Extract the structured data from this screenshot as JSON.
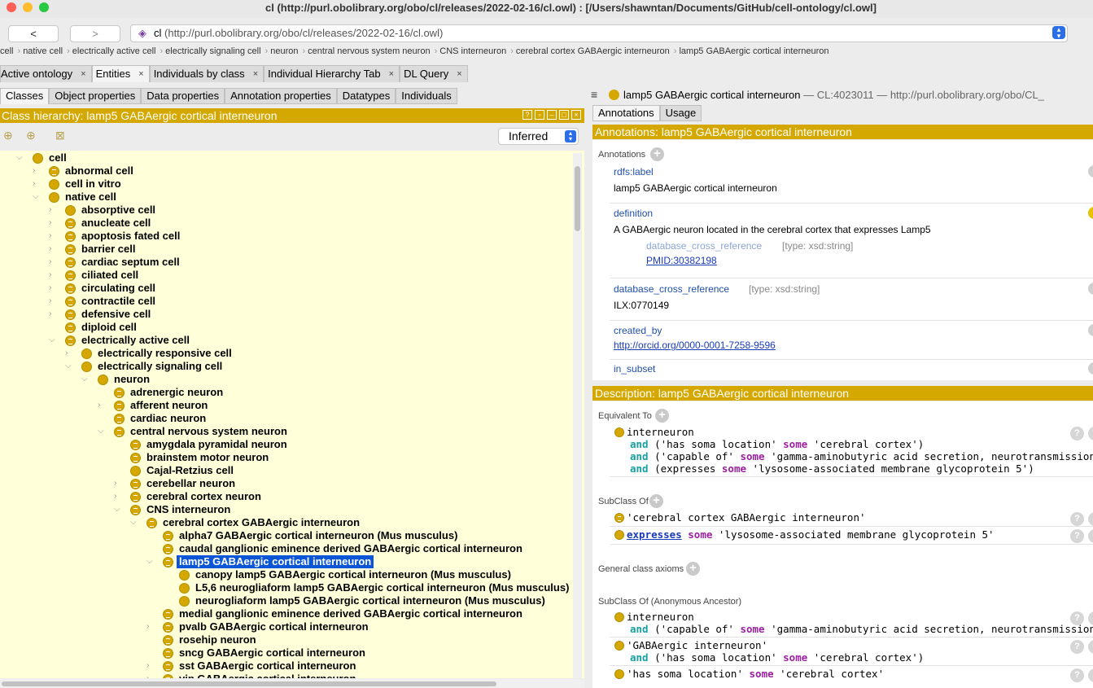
{
  "window": {
    "title": "cl (http://purl.obolibrary.org/obo/cl/releases/2022-02-16/cl.owl)  : [/Users/shawntan/Documents/GitHub/cell-ontology/cl.owl]"
  },
  "nav": {
    "back": "<",
    "forward": ">",
    "url_name": "cl",
    "url_rest": "(http://purl.obolibrary.org/obo/cl/releases/2022-02-16/cl.owl)"
  },
  "breadcrumbs": [
    "cell",
    "native cell",
    "electrically active cell",
    "electrically signaling cell",
    "neuron",
    "central nervous system neuron",
    "CNS interneuron",
    "cerebral cortex GABAergic interneuron",
    "lamp5 GABAergic cortical interneuron"
  ],
  "main_tabs": [
    {
      "label": "Active ontology",
      "close": "×"
    },
    {
      "label": "Entities",
      "close": "×"
    },
    {
      "label": "Individuals by class",
      "close": "×"
    },
    {
      "label": "Individual Hierarchy Tab",
      "close": "×"
    },
    {
      "label": "DL Query",
      "close": "×"
    }
  ],
  "entity_tabs": [
    "Classes",
    "Object properties",
    "Data properties",
    "Annotation properties",
    "Datatypes",
    "Individuals"
  ],
  "hierarchy": {
    "header": "Class hierarchy: lamp5 GABAergic cortical interneuron",
    "mode": "Inferred",
    "rows": [
      {
        "label": "cell"
      },
      {
        "label": "abnormal cell"
      },
      {
        "label": "cell in vitro"
      },
      {
        "label": "native cell"
      },
      {
        "label": "absorptive cell"
      },
      {
        "label": "anucleate cell"
      },
      {
        "label": "apoptosis fated cell"
      },
      {
        "label": "barrier cell"
      },
      {
        "label": "cardiac septum cell"
      },
      {
        "label": "ciliated cell"
      },
      {
        "label": "circulating cell"
      },
      {
        "label": "contractile cell"
      },
      {
        "label": "defensive cell"
      },
      {
        "label": "diploid cell"
      },
      {
        "label": "electrically active cell"
      },
      {
        "label": "electrically responsive cell"
      },
      {
        "label": "electrically signaling cell"
      },
      {
        "label": "neuron"
      },
      {
        "label": "adrenergic neuron"
      },
      {
        "label": "afferent neuron"
      },
      {
        "label": "cardiac neuron"
      },
      {
        "label": "central nervous system neuron"
      },
      {
        "label": "amygdala pyramidal neuron"
      },
      {
        "label": "brainstem motor neuron"
      },
      {
        "label": "Cajal-Retzius cell"
      },
      {
        "label": "cerebellar neuron"
      },
      {
        "label": "cerebral cortex neuron"
      },
      {
        "label": "CNS interneuron"
      },
      {
        "label": "cerebral cortex GABAergic interneuron"
      },
      {
        "label": "alpha7 GABAergic cortical interneuron (Mus musculus)"
      },
      {
        "label": "caudal ganglionic eminence derived GABAergic cortical interneuron"
      },
      {
        "label": "lamp5 GABAergic cortical interneuron"
      },
      {
        "label": "canopy lamp5 GABAergic cortical interneuron (Mus musculus)"
      },
      {
        "label": "L5,6 neurogliaform lamp5 GABAergic cortical interneuron (Mus musculus)"
      },
      {
        "label": "neurogliaform lamp5 GABAergic cortical interneuron (Mus musculus)"
      },
      {
        "label": "medial ganglionic eminence derived GABAergic cortical interneuron"
      },
      {
        "label": "pvalb GABAergic cortical interneuron"
      },
      {
        "label": "rosehip neuron"
      },
      {
        "label": "sncg GABAergic cortical interneuron"
      },
      {
        "label": "sst GABAergic cortical interneuron"
      },
      {
        "label": "vip GABAergic cortical interneuron"
      }
    ]
  },
  "entity": {
    "name": "lamp5 GABAergic cortical interneuron",
    "rest": " — CL:4023011 — http://purl.obolibrary.org/obo/CL_"
  },
  "right_tabs": [
    "Annotations",
    "Usage"
  ],
  "annotations": {
    "header": "Annotations: lamp5 GABAergic cortical interneuron",
    "section_label": "Annotations",
    "label_prop": "rdfs:label",
    "label_val": "lamp5 GABAergic cortical interneuron",
    "def_prop": "definition",
    "def_val": "A GABAergic neuron located in the cerebral cortex that expresses Lamp5",
    "def_xref_prop": "database_cross_reference",
    "def_xref_type": "[type: xsd:string]",
    "def_xref_val": "PMID:30382198",
    "xref_prop": "database_cross_reference",
    "xref_type": "[type: xsd:string]",
    "xref_val": "ILX:0770149",
    "created_prop": "created_by",
    "created_val": "http://orcid.org/0000-0001-7258-9596",
    "subset_prop": "in_subset"
  },
  "description": {
    "header": "Description: lamp5 GABAergic cortical interneuron",
    "equiv_label": "Equivalent To",
    "equiv": {
      "cls": "interneuron",
      "and": "and",
      "some": "some",
      "r1_prop": "('has soma location'",
      "r1_val": "'cerebral cortex')",
      "r2_prop": "('capable of'",
      "r2_val": "'gamma-aminobutyric acid secretion, neurotransmission')",
      "r3_prop": "(expresses",
      "r3_val": "'lysosome-associated membrane glycoprotein 5')"
    },
    "subclass_label": "SubClass Of",
    "sub1": "'cerebral cortex GABAergic interneuron'",
    "sub2_prop": "expresses",
    "sub2_val": "'lysosome-associated membrane glycoprotein 5'",
    "gca_label": "General class axioms",
    "anon_label": "SubClass Of (Anonymous Ancestor)",
    "anon1_cls": "interneuron",
    "anon1_prop": "('capable of'",
    "anon1_val": "'gamma-aminobutyric acid secretion, neurotransmission')",
    "anon2_cls": "'GABAergic interneuron'",
    "anon2_prop": "('has soma location'",
    "anon2_val": "'cerebral cortex')",
    "anon3_prop": "'has soma location'",
    "anon3_val": "'cerebral cortex'"
  },
  "colors": {
    "accent": "#d4a800",
    "tree_bg": "#ffffd9",
    "selection": "#0b56d6",
    "keyword_and": "#18a0a0",
    "keyword_some": "#9b1fa0"
  }
}
